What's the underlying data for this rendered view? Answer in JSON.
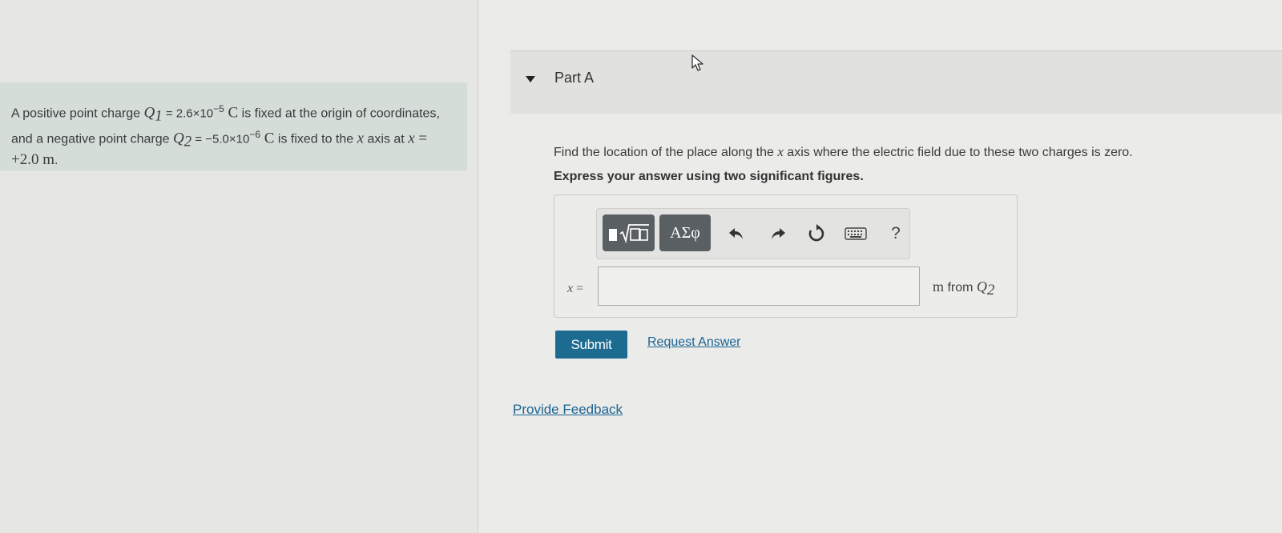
{
  "problem": {
    "t1": "A positive point charge ",
    "q1_sym": "Q",
    "q1_sub": "1",
    "q1_eq": " = 2.6×10",
    "q1_exp": "−5",
    "unit_c1": " C",
    "t2": " is fixed at the origin of coordinates, and a negative point charge ",
    "q2_sym": "Q",
    "q2_sub": "2",
    "q2_eq": " = −5.0×10",
    "q2_exp": "−6",
    "unit_c2": " C",
    "t3": " is fixed to the ",
    "x_sym": "x",
    "t4": " axis at ",
    "x_sym2": "x",
    "x_val": " = +2.0 m",
    "t5": "."
  },
  "part": {
    "title": "Part A"
  },
  "question": {
    "pre": "Find the location of the place along the ",
    "x_sym": "x",
    "post": " axis where the electric field due to these two charges is zero.",
    "instruction": "Express your answer using two significant figures."
  },
  "toolbar": {
    "templates_label": "▮√▯",
    "greek_label": "ΑΣφ",
    "help_label": "?"
  },
  "answer": {
    "var": "x",
    "eq": " =",
    "value": "",
    "unit_m": "m",
    "unit_from": " from ",
    "unit_q": "Q",
    "unit_q_sub": "2"
  },
  "actions": {
    "submit": "Submit",
    "request_answer": "Request Answer",
    "provide_feedback": "Provide Feedback"
  },
  "colors": {
    "submit_bg": "#1d6b90",
    "link": "#1b6494",
    "problem_bg": "#d5ddd9"
  }
}
